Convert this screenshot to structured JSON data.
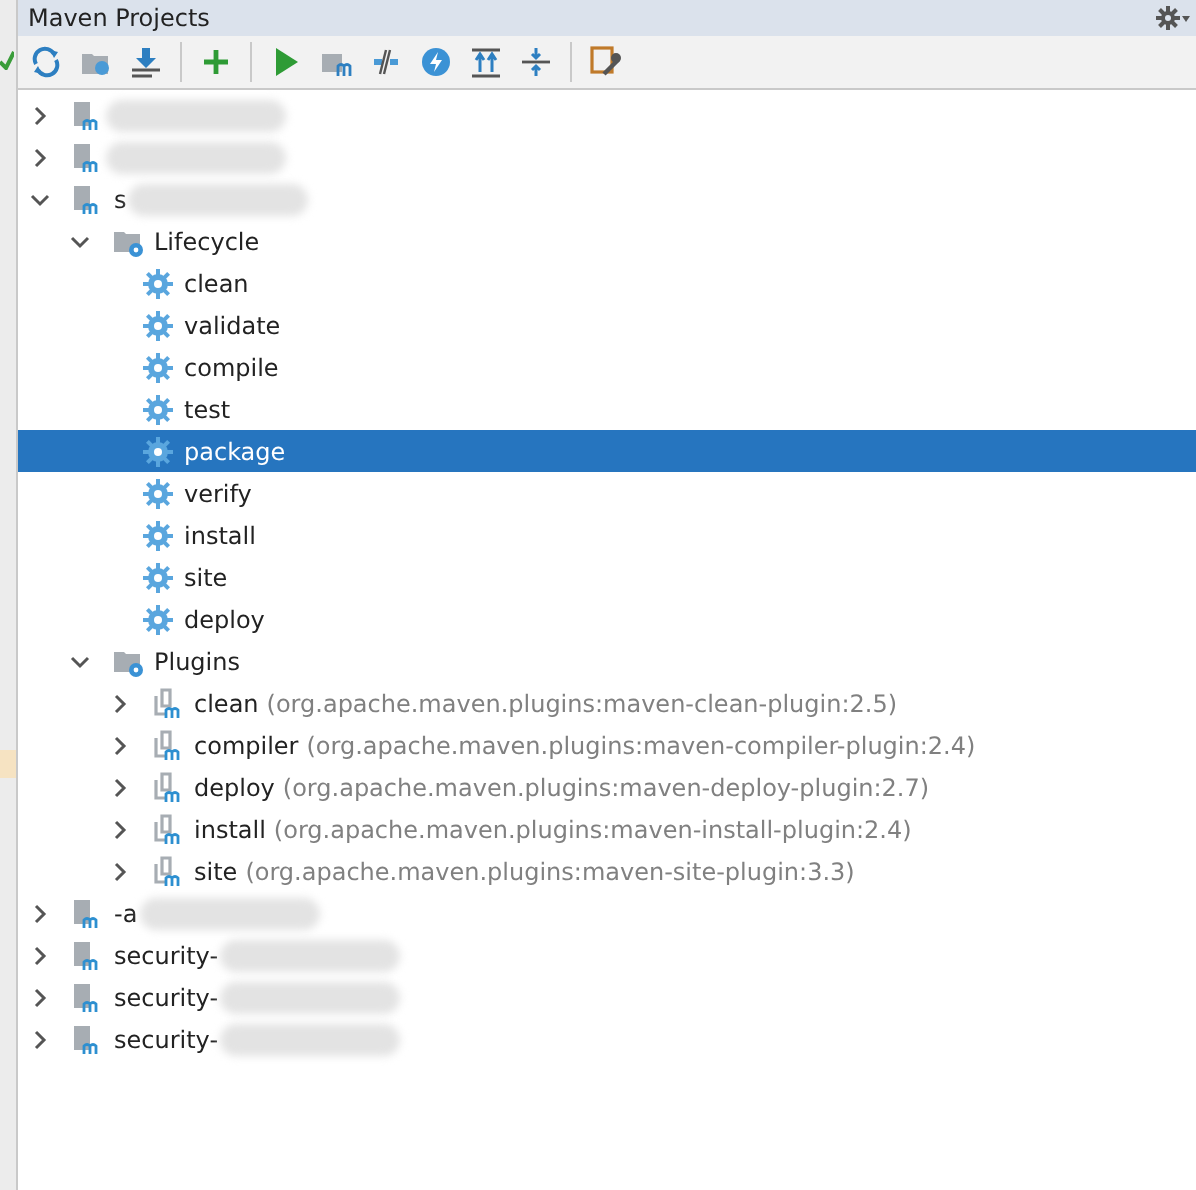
{
  "window": {
    "title": "Maven Projects"
  },
  "tree": [
    {
      "kind": "module",
      "blurred": true,
      "expanded": false
    },
    {
      "kind": "module",
      "blurred": true,
      "expanded": false
    },
    {
      "kind": "module",
      "label": "s",
      "blurred": true,
      "expanded": true,
      "children": [
        {
          "kind": "folder",
          "label": "Lifecycle",
          "expanded": true,
          "children": [
            {
              "kind": "goal",
              "label": "clean",
              "selected": false
            },
            {
              "kind": "goal",
              "label": "validate",
              "selected": false
            },
            {
              "kind": "goal",
              "label": "compile",
              "selected": false
            },
            {
              "kind": "goal",
              "label": "test",
              "selected": false
            },
            {
              "kind": "goal",
              "label": "package",
              "selected": true
            },
            {
              "kind": "goal",
              "label": "verify",
              "selected": false
            },
            {
              "kind": "goal",
              "label": "install",
              "selected": false
            },
            {
              "kind": "goal",
              "label": "site",
              "selected": false
            },
            {
              "kind": "goal",
              "label": "deploy",
              "selected": false
            }
          ]
        },
        {
          "kind": "folder",
          "label": "Plugins",
          "expanded": true,
          "children": [
            {
              "kind": "plugin",
              "label": "clean",
              "detail": "(org.apache.maven.plugins:maven-clean-plugin:2.5)",
              "expanded": false
            },
            {
              "kind": "plugin",
              "label": "compiler",
              "detail": "(org.apache.maven.plugins:maven-compiler-plugin:2.4)",
              "expanded": false
            },
            {
              "kind": "plugin",
              "label": "deploy",
              "detail": "(org.apache.maven.plugins:maven-deploy-plugin:2.7)",
              "expanded": false
            },
            {
              "kind": "plugin",
              "label": "install",
              "detail": "(org.apache.maven.plugins:maven-install-plugin:2.4)",
              "expanded": false
            },
            {
              "kind": "plugin",
              "label": "site",
              "detail": "(org.apache.maven.plugins:maven-site-plugin:3.3)",
              "expanded": false
            }
          ]
        }
      ]
    },
    {
      "kind": "module",
      "label": "-a",
      "blurred": true,
      "expanded": false
    },
    {
      "kind": "module",
      "label": "security-",
      "blurred": true,
      "expanded": false
    },
    {
      "kind": "module",
      "label": "security-",
      "blurred": true,
      "expanded": false
    },
    {
      "kind": "module",
      "label": "security-",
      "blurred": true,
      "expanded": false
    }
  ]
}
